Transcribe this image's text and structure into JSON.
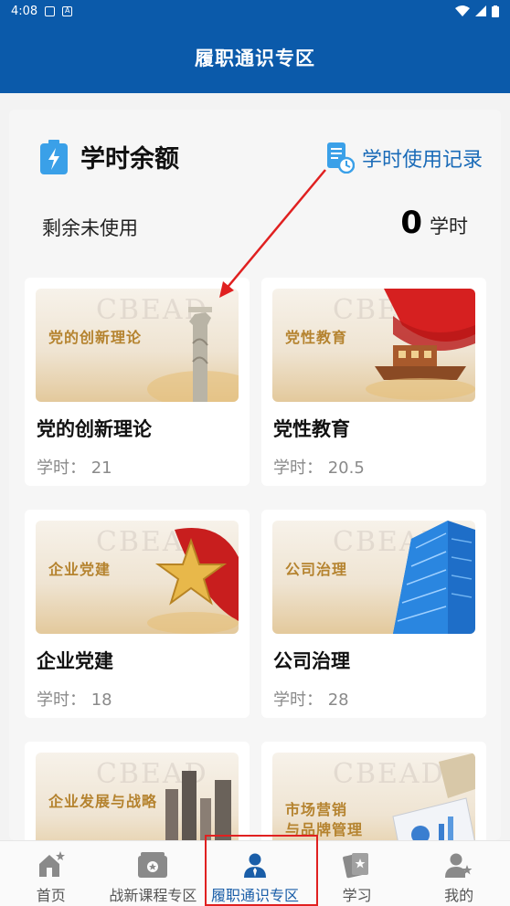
{
  "status_bar": {
    "time": "4:08"
  },
  "app_bar": {
    "title": "履职通识专区"
  },
  "balance": {
    "title": "学时余额",
    "record_link": "学时使用记录",
    "remain_label": "剩余未使用",
    "remain_value": "0",
    "remain_unit": "学时"
  },
  "courses": [
    {
      "banner_text": "党的创新理论",
      "name": "党的创新理论",
      "hours": "学时： 21"
    },
    {
      "banner_text": "党性教育",
      "name": "党性教育",
      "hours": "学时： 20.5"
    },
    {
      "banner_text": "企业党建",
      "name": "企业党建",
      "hours": "学时： 18"
    },
    {
      "banner_text": "公司治理",
      "name": "公司治理",
      "hours": "学时： 28"
    },
    {
      "banner_text": "企业发展与战略",
      "name": "",
      "hours": ""
    },
    {
      "banner_text_line1": "市场营销",
      "banner_text_line2": "与品牌管理",
      "name": "",
      "hours": ""
    }
  ],
  "watermark": "CBEAD",
  "nav": [
    {
      "label": "首页",
      "icon": "home-star-icon"
    },
    {
      "label": "战新课程专区",
      "icon": "wallet-icon"
    },
    {
      "label": "履职通识专区",
      "icon": "person-tie-icon",
      "active": true
    },
    {
      "label": "学习",
      "icon": "cards-star-icon"
    },
    {
      "label": "我的",
      "icon": "user-star-icon"
    }
  ],
  "colors": {
    "primary": "#0b5aaa",
    "link": "#1a6bb8",
    "highlight": "#e02020",
    "banner_gold": "#b5832f"
  }
}
